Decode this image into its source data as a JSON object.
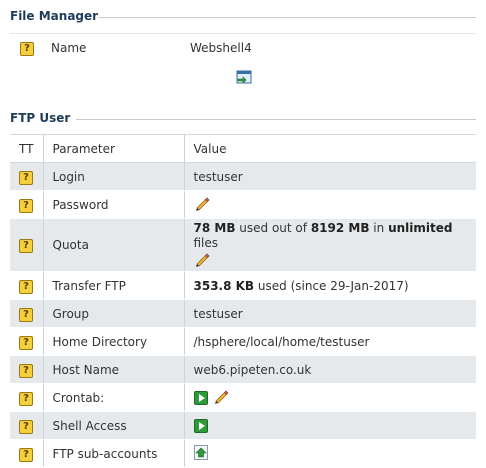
{
  "file_manager": {
    "title": "File Manager",
    "name_label": "Name",
    "name_value": "Webshell4",
    "help_glyph": "?",
    "open_icon": "open-window-icon"
  },
  "ftp_user": {
    "title": "FTP User",
    "headers": {
      "tt": "TT",
      "parameter": "Parameter",
      "value": "Value"
    },
    "login": {
      "label": "Login",
      "value": "testuser"
    },
    "password": {
      "label": "Password",
      "icon": "pencil-icon"
    },
    "quota": {
      "label": "Quota",
      "used": "78 MB",
      "text1": " used out of ",
      "total": "8192 MB",
      "text2": " in ",
      "files": "unlimited",
      "text3": " files"
    },
    "transfer": {
      "label": "Transfer FTP",
      "amount": "353.8 KB",
      "text": " used (since 29-Jan-2017)"
    },
    "group": {
      "label": "Group",
      "value": "testuser"
    },
    "home_dir": {
      "label": "Home Directory",
      "value": "/hsphere/local/home/testuser"
    },
    "host_name": {
      "label": "Host Name",
      "value": "web6.pipeten.co.uk"
    },
    "crontab": {
      "label": "Crontab:"
    },
    "shell_access": {
      "label": "Shell Access"
    },
    "sub_accounts": {
      "label": "FTP sub-accounts"
    }
  },
  "colors": {
    "section_title": "#1e3c5a",
    "row_alt": "#e6e9ec",
    "help_icon": "#f6cf3c",
    "play_icon": "#2f9a3a"
  }
}
